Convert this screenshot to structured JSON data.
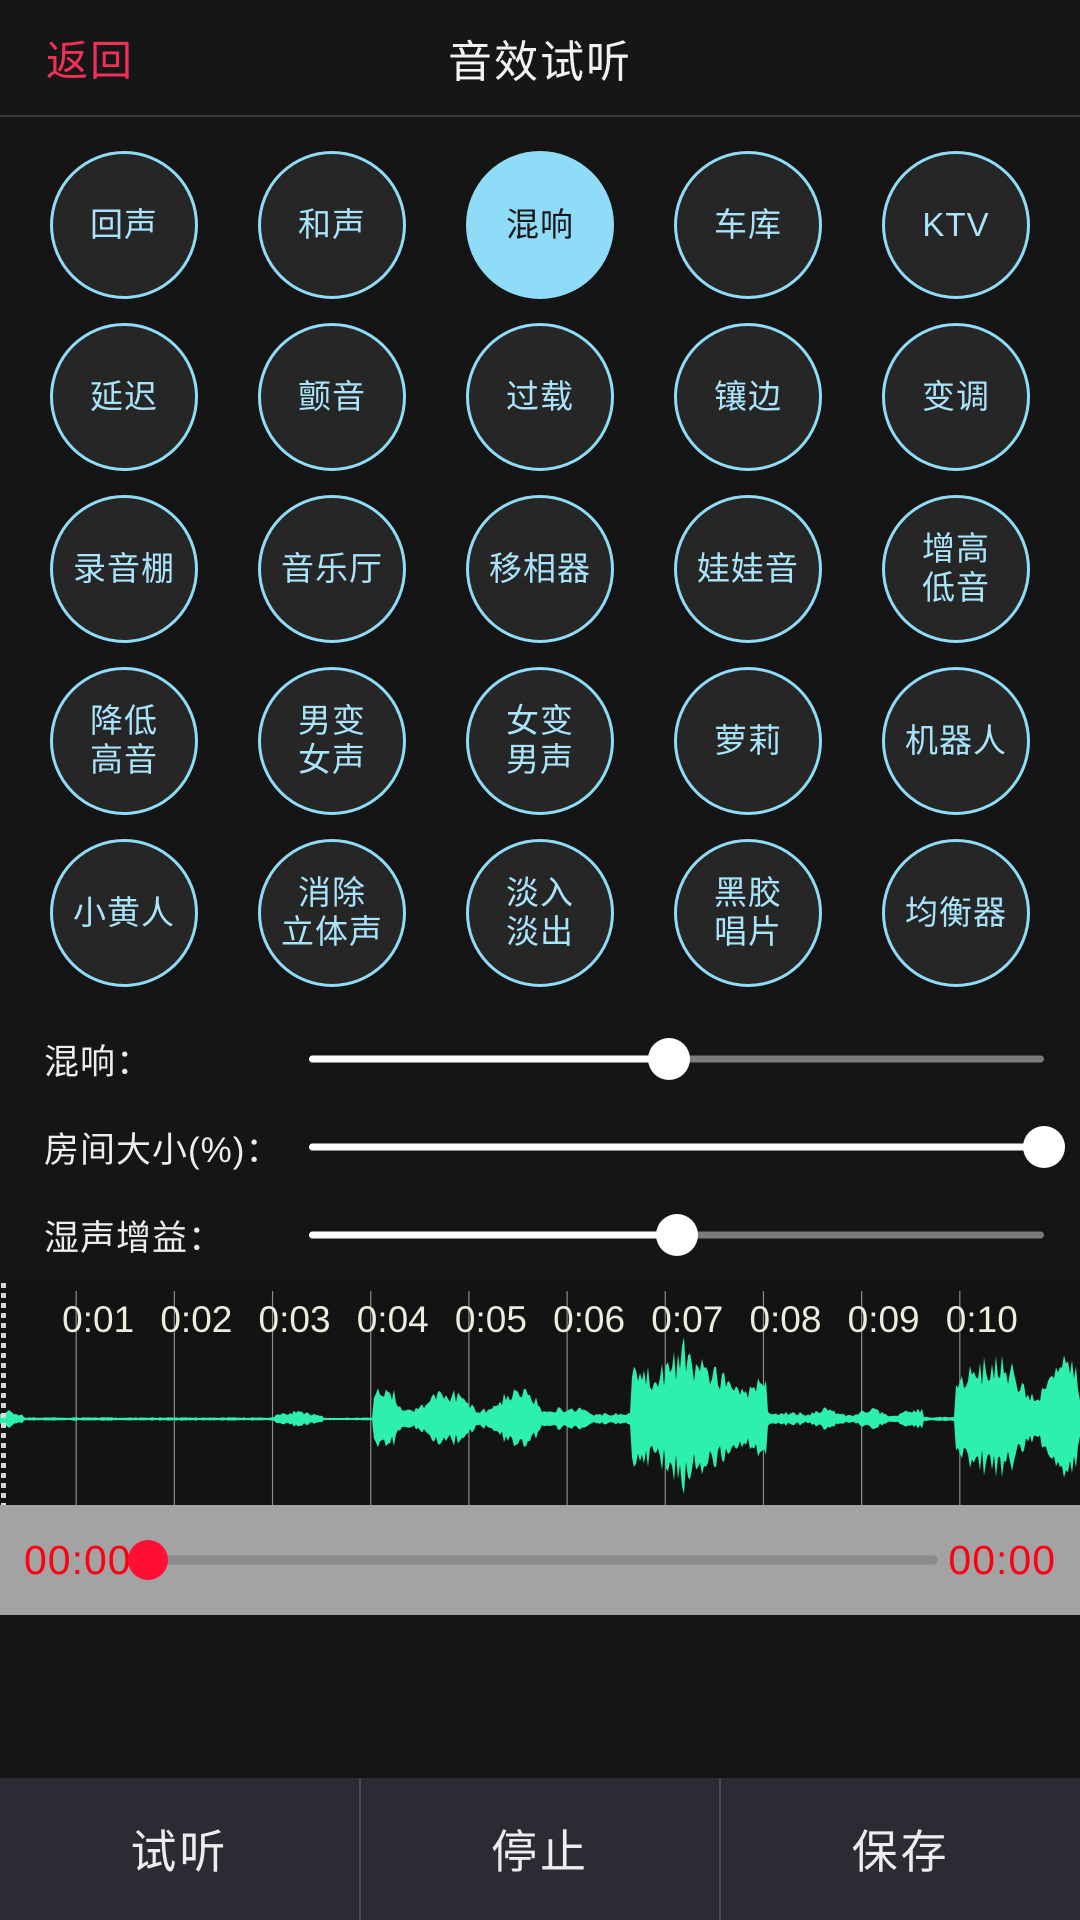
{
  "header": {
    "back_label": "返回",
    "title": "音效试听",
    "back_color": "#f22f54"
  },
  "effects": {
    "selected": "混响",
    "accent": "#8fdcf8",
    "items": [
      {
        "label": "回声",
        "selected": false
      },
      {
        "label": "和声",
        "selected": false
      },
      {
        "label": "混响",
        "selected": true
      },
      {
        "label": "车库",
        "selected": false
      },
      {
        "label": "KTV",
        "selected": false
      },
      {
        "label": "延迟",
        "selected": false
      },
      {
        "label": "颤音",
        "selected": false
      },
      {
        "label": "过载",
        "selected": false
      },
      {
        "label": "镶边",
        "selected": false
      },
      {
        "label": "变调",
        "selected": false
      },
      {
        "label": "录音棚",
        "selected": false
      },
      {
        "label": "音乐厅",
        "selected": false
      },
      {
        "label": "移相器",
        "selected": false
      },
      {
        "label": "娃娃音",
        "selected": false
      },
      {
        "label": "增高\n低音",
        "selected": false
      },
      {
        "label": "降低\n高音",
        "selected": false
      },
      {
        "label": "男变\n女声",
        "selected": false
      },
      {
        "label": "女变\n男声",
        "selected": false
      },
      {
        "label": "萝莉",
        "selected": false
      },
      {
        "label": "机器人",
        "selected": false
      },
      {
        "label": "小黄人",
        "selected": false
      },
      {
        "label": "消除\n立体声",
        "selected": false
      },
      {
        "label": "淡入\n淡出",
        "selected": false
      },
      {
        "label": "黑胶\n唱片",
        "selected": false
      },
      {
        "label": "均衡器",
        "selected": false
      }
    ]
  },
  "sliders": [
    {
      "label": "混响：",
      "value": 49
    },
    {
      "label": "房间大小(%)：",
      "value": 100
    },
    {
      "label": "湿声增益：",
      "value": 50
    }
  ],
  "waveform": {
    "wave_color": "#2cf0ab",
    "ruler_color": "#eeecdd",
    "ticks": [
      "0:01",
      "0:02",
      "0:03",
      "0:04",
      "0:05",
      "0:06",
      "0:07",
      "0:08",
      "0:09",
      "0:10"
    ],
    "playhead_position": 0
  },
  "scrubber": {
    "current_time": "00:00",
    "total_time": "00:00",
    "progress": 0,
    "time_color": "#fe0014",
    "thumb_color": "#fe0f33",
    "background": "#a3a3a3"
  },
  "bottom_bar": {
    "preview_label": "试听",
    "stop_label": "停止",
    "save_label": "保存"
  }
}
